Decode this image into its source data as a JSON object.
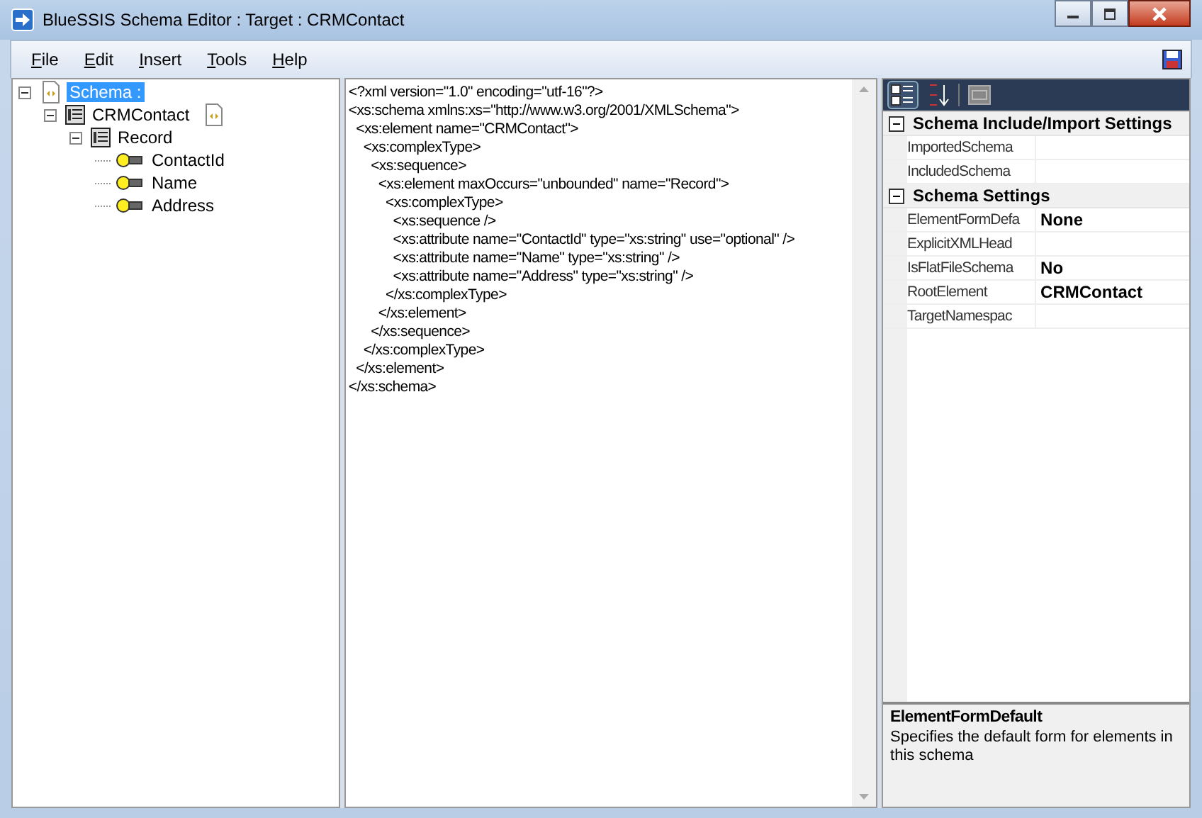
{
  "window": {
    "title": "BlueSSIS Schema Editor : Target : CRMContact"
  },
  "menu": [
    {
      "label": "File"
    },
    {
      "label": "Edit"
    },
    {
      "label": "Insert"
    },
    {
      "label": "Tools"
    },
    {
      "label": "Help"
    }
  ],
  "tree": [
    {
      "label": "Schema :",
      "kind": "schema",
      "selected": true,
      "expanded": true,
      "children": [
        {
          "label": "CRMContact",
          "kind": "root",
          "selected": false,
          "expanded": true,
          "children": [
            {
              "label": "Record",
              "kind": "record",
              "selected": false,
              "expanded": true,
              "children": [
                {
                  "label": "ContactId",
                  "kind": "attribute",
                  "selected": false
                },
                {
                  "label": "Name",
                  "kind": "attribute",
                  "selected": false
                },
                {
                  "label": "Address",
                  "kind": "attribute",
                  "selected": false
                }
              ]
            }
          ]
        }
      ]
    }
  ],
  "xml_lines": [
    "<?xml version=\"1.0\" encoding=\"utf-16\"?>",
    "<xs:schema xmlns:xs=\"http://www.w3.org/2001/XMLSchema\">",
    "  <xs:element name=\"CRMContact\">",
    "    <xs:complexType>",
    "      <xs:sequence>",
    "        <xs:element maxOccurs=\"unbounded\" name=\"Record\">",
    "          <xs:complexType>",
    "            <xs:sequence />",
    "            <xs:attribute name=\"ContactId\" type=\"xs:string\" use=\"optional\" />",
    "            <xs:attribute name=\"Name\" type=\"xs:string\" />",
    "            <xs:attribute name=\"Address\" type=\"xs:string\" />",
    "          </xs:complexType>",
    "        </xs:element>",
    "      </xs:sequence>",
    "    </xs:complexType>",
    "  </xs:element>",
    "</xs:schema>"
  ],
  "properties": {
    "categories": [
      {
        "title": "Schema Include/Import Settings",
        "expanded": true,
        "items": [
          {
            "name": "ImportedSchema"
          },
          {
            "name": "IncludedSchema"
          }
        ]
      },
      {
        "title": "Schema Settings",
        "expanded": true,
        "items": [
          {
            "name": "ElementFormDefa",
            "value": "None"
          },
          {
            "name": "ExplicitXMLHead"
          },
          {
            "name": "IsFlatFileSchema",
            "value": "No"
          },
          {
            "name": "RootElement",
            "value": "CRMContact"
          },
          {
            "name": "TargetNamespac"
          }
        ]
      }
    ],
    "description": {
      "title": "ElementFormDefault",
      "text": "Specifies the default form for elements in this schema"
    }
  }
}
